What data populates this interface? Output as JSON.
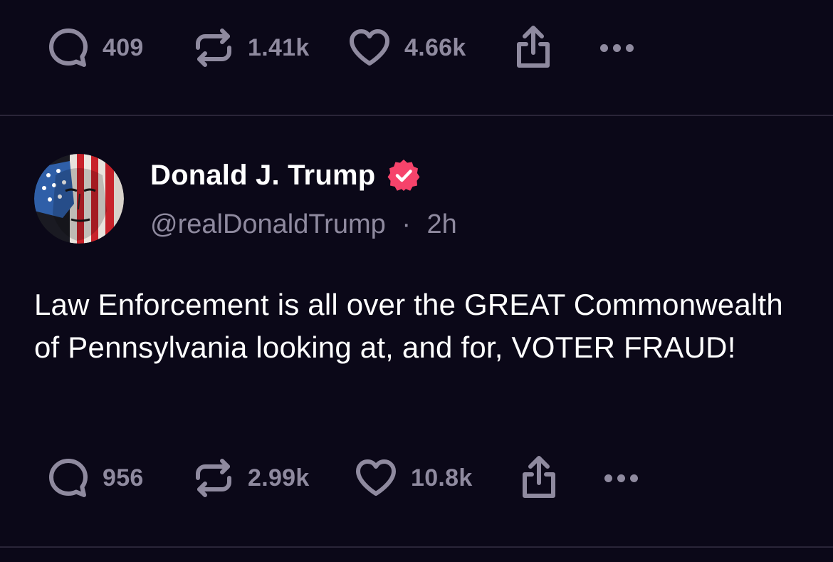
{
  "previous_post": {
    "actions": {
      "replies": "409",
      "reposts": "1.41k",
      "likes": "4.66k"
    }
  },
  "post": {
    "author": {
      "name": "Donald J. Trump",
      "handle": "@realDonaldTrump",
      "separator": "·",
      "time": "2h",
      "verified": true,
      "verified_color": "#f6436b"
    },
    "text": "Law Enforcement is all over the GREAT Commonwealth of Pennsylvania looking at, and for, VOTER FRAUD!",
    "actions": {
      "replies": "956",
      "reposts": "2.99k",
      "likes": "10.8k"
    }
  },
  "icons": {
    "reply": "speech-bubble-icon",
    "repost": "repost-arrows-icon",
    "like": "heart-icon",
    "share": "share-upload-icon",
    "more": "more-dots-icon"
  },
  "colors": {
    "background": "#0b0818",
    "muted_text": "#8f8a9f",
    "divider": "#2a2538"
  }
}
